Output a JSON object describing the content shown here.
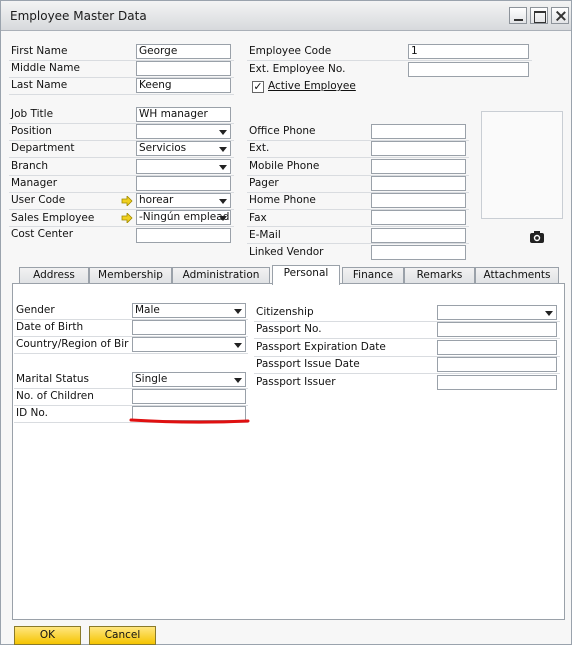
{
  "window": {
    "title": "Employee Master Data"
  },
  "header_left": [
    {
      "label": "First Name",
      "value": "George"
    },
    {
      "label": "Middle Name",
      "value": ""
    },
    {
      "label": "Last Name",
      "value": "Keeng"
    }
  ],
  "header_right": {
    "employee_code_label": "Employee Code",
    "employee_code": "1",
    "ext_employee_label": "Ext. Employee No.",
    "ext_employee": "",
    "active_label": "Active Employee",
    "active_checked": "✓"
  },
  "job": {
    "job_title_label": "Job Title",
    "job_title": "WH manager",
    "position_label": "Position",
    "position": "",
    "department_label": "Department",
    "department": "Servicios",
    "branch_label": "Branch",
    "branch": "",
    "manager_label": "Manager",
    "manager": "",
    "user_code_label": "User Code",
    "user_code": "horear",
    "sales_employee_label": "Sales Employee",
    "sales_employee": "-Ningún empleado-",
    "cost_center_label": "Cost Center",
    "cost_center": ""
  },
  "contact": [
    {
      "label": "Office Phone",
      "value": ""
    },
    {
      "label": "Ext.",
      "value": ""
    },
    {
      "label": "Mobile Phone",
      "value": ""
    },
    {
      "label": "Pager",
      "value": ""
    },
    {
      "label": "Home Phone",
      "value": ""
    },
    {
      "label": "Fax",
      "value": ""
    },
    {
      "label": "E-Mail",
      "value": ""
    },
    {
      "label": "Linked Vendor",
      "value": ""
    }
  ],
  "tabs": [
    "Address",
    "Membership",
    "Administration",
    "Personal",
    "Finance",
    "Remarks",
    "Attachments"
  ],
  "personal_left": {
    "gender_label": "Gender",
    "gender": "Male",
    "dob_label": "Date of Birth",
    "dob": "",
    "country_label": "Country/Region of Bir",
    "country": "",
    "marital_label": "Marital Status",
    "marital": "Single",
    "children_label": "No. of Children",
    "children": "",
    "id_label": "ID No.",
    "id": ""
  },
  "personal_right": {
    "citizenship_label": "Citizenship",
    "citizenship": "",
    "passport_no_label": "Passport No.",
    "passport_no": "",
    "passport_exp_label": "Passport Expiration Date",
    "passport_exp": "",
    "passport_issue_label": "Passport Issue Date",
    "passport_issue": "",
    "passport_issuer_label": "Passport Issuer",
    "passport_issuer": ""
  },
  "buttons": {
    "ok": "OK",
    "cancel": "Cancel"
  },
  "icons": [
    "link-arrow-icon",
    "camera-icon",
    "dropdown-arrow-icon",
    "minimize-icon",
    "maximize-icon",
    "close-icon"
  ],
  "colors": {
    "button_yellow": "#f5c400",
    "annotation_red": "#e01010"
  }
}
